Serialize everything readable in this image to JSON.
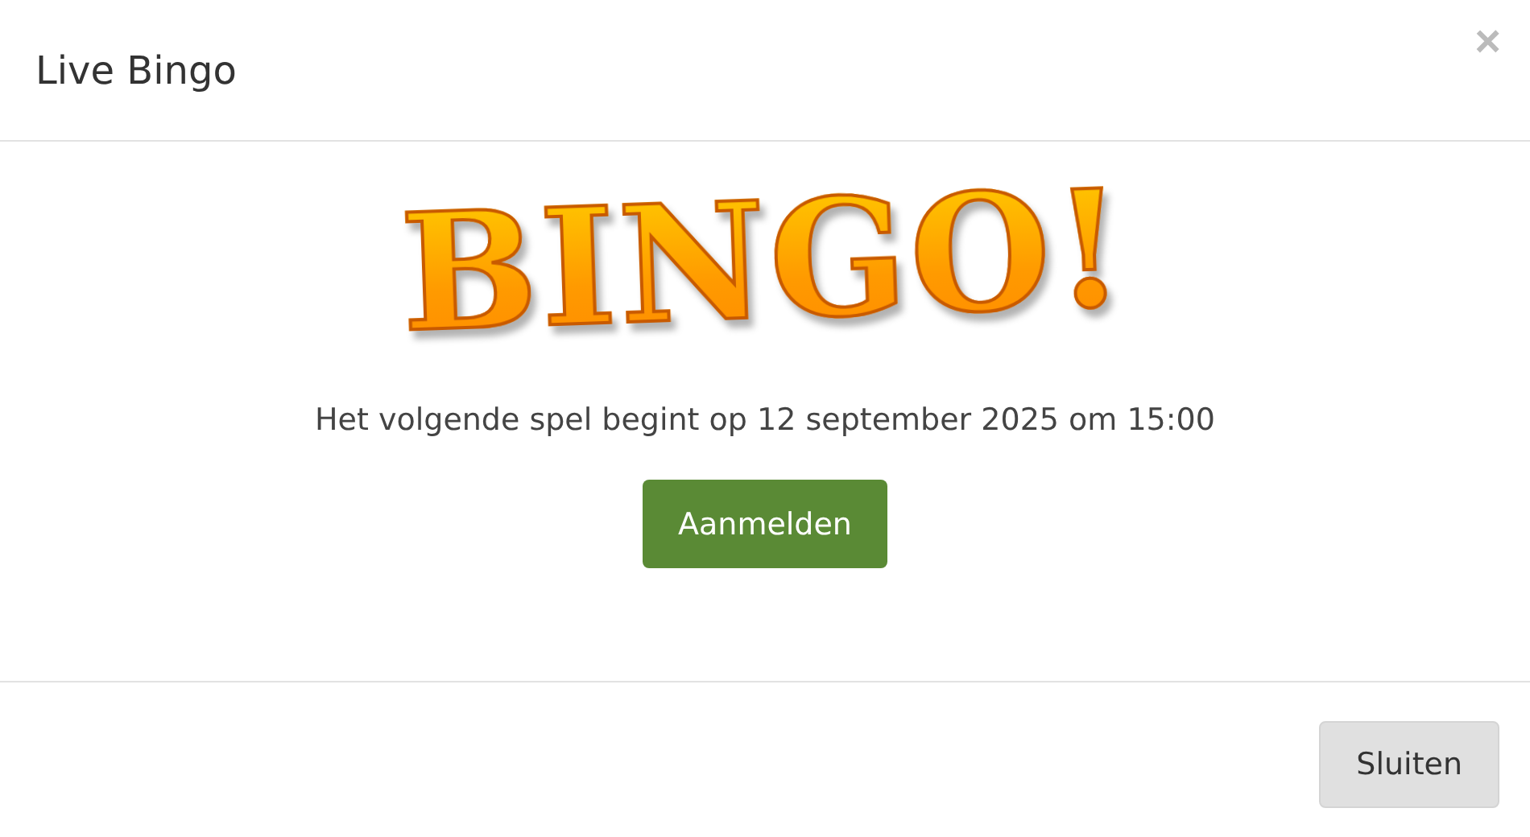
{
  "dialog": {
    "title": "Live Bingo",
    "close_label": "×"
  },
  "logo": {
    "text": "BINGO!"
  },
  "message": "Het volgende spel begint op 12 september 2025 om 15:00",
  "primary_button": "Aanmelden",
  "footer_button": "Sluiten"
}
